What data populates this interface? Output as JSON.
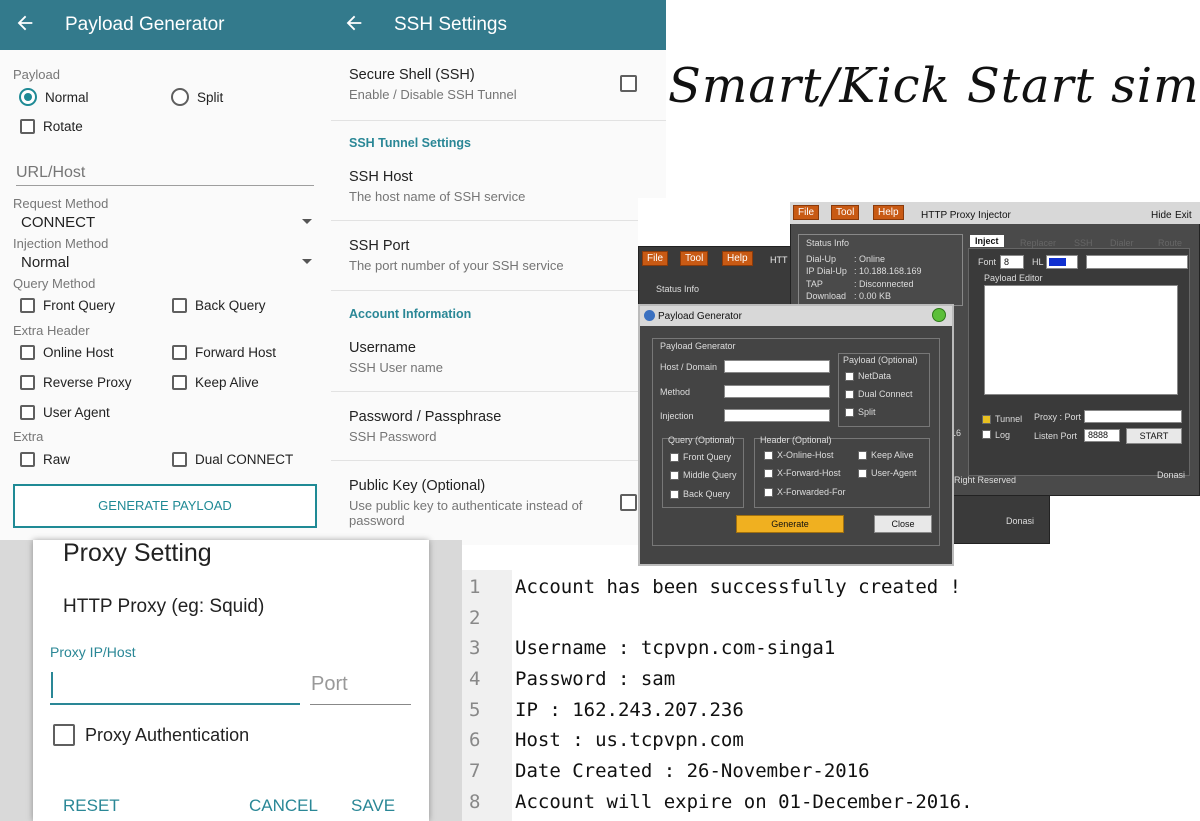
{
  "payload_generator": {
    "title": "Payload Generator",
    "payload_label": "Payload",
    "normal": "Normal",
    "split": "Split",
    "rotate": "Rotate",
    "url_placeholder": "URL/Host",
    "request_method_label": "Request Method",
    "request_method_value": "CONNECT",
    "injection_method_label": "Injection Method",
    "injection_method_value": "Normal",
    "query_method_label": "Query Method",
    "front_query": "Front Query",
    "back_query": "Back Query",
    "extra_header_label": "Extra Header",
    "online_host": "Online Host",
    "forward_host": "Forward Host",
    "reverse_proxy": "Reverse Proxy",
    "keep_alive": "Keep Alive",
    "user_agent": "User Agent",
    "extra_label": "Extra",
    "raw": "Raw",
    "dual_connect": "Dual CONNECT",
    "generate_button": "GENERATE PAYLOAD"
  },
  "ssh_settings": {
    "title": "SSH Settings",
    "secure_shell": "Secure Shell (SSH)",
    "secure_shell_sub": "Enable / Disable SSH Tunnel",
    "tunnel_section": "SSH Tunnel Settings",
    "ssh_host": "SSH Host",
    "ssh_host_sub": "The host name of SSH service",
    "ssh_port": "SSH Port",
    "ssh_port_sub": "The port number of your SSH service",
    "account_section": "Account Information",
    "username": "Username",
    "username_sub": "SSH User name",
    "password": "Password / Passphrase",
    "password_sub": "SSH Password",
    "public_key": "Public Key (Optional)",
    "public_key_sub": "Use public key to authenticate instead of password"
  },
  "proxy_setting": {
    "title": "Proxy Setting",
    "subtitle": "HTTP Proxy (eg: Squid)",
    "ip_label": "Proxy IP/Host",
    "port_placeholder": "Port",
    "auth": "Proxy Authentication",
    "reset": "RESET",
    "cancel": "CANCEL",
    "save": "SAVE"
  },
  "handwritten_title": "Smart/Kick Start sim",
  "injector": {
    "menu_file": "File",
    "menu_tool": "Tool",
    "menu_help": "Help",
    "title": "HTTP Proxy Injector",
    "hide": "Hide",
    "exit": "Exit",
    "status_info": "Status Info",
    "dialup": "Dial-Up",
    "dialup_val": ": Online",
    "ip_dialup": "IP Dial-Up",
    "ip_val": ": 10.188.168.169",
    "tap": "TAP",
    "tap_val": ": Disconnected",
    "download": "Download",
    "download_val": ": 0.00 KB",
    "tabs": [
      "Inject",
      "Replacer",
      "SSH",
      "Dialer",
      "Route"
    ],
    "font_label": "Font",
    "font_size": "8",
    "hl_label": "HL",
    "payload_editor": "Payload Editor",
    "tunnel": "Tunnel",
    "log": "Log",
    "proxy_port": "Proxy : Port",
    "listen_port": "Listen Port",
    "listen_value": "8888",
    "start": "START",
    "right_reserved": "Right Reserved",
    "donasi": "Donasi",
    "dialog_title": "Payload Generator",
    "dialog_group": "Payload Generator",
    "host_domain": "Host / Domain",
    "method": "Method",
    "injection": "Injection",
    "payload_optional": "Payload (Optional)",
    "netdata": "NetData",
    "dual_connect": "Dual Connect",
    "split": "Split",
    "query_optional": "Query (Optional)",
    "front_query": "Front Query",
    "middle_query": "Middle Query",
    "back_query": "Back Query",
    "header_optional": "Header (Optional)",
    "x_online_host": "X-Online-Host",
    "x_forward_host": "X-Forward-Host",
    "x_forwarded_for": "X-Forwarded-For",
    "keep_alive": "Keep Alive",
    "user_agent": "User-Agent",
    "generate": "Generate",
    "close": "Close",
    "back_status_info": "Status Info",
    "back_title_partial": "HTT",
    "side_16": "16"
  },
  "code_editor": {
    "lines": [
      {
        "num": "1",
        "text": "Account has been successfully created !"
      },
      {
        "num": "2",
        "text": ""
      },
      {
        "num": "3",
        "text": "Username : tcpvpn.com-singa1"
      },
      {
        "num": "4",
        "text": "Password : sam"
      },
      {
        "num": "5",
        "text": "IP : 162.243.207.236"
      },
      {
        "num": "6",
        "text": "Host : us.tcpvpn.com"
      },
      {
        "num": "7",
        "text": "Date Created : 26-November-2016"
      },
      {
        "num": "8",
        "text": "Account will expire on 01-December-2016."
      }
    ]
  },
  "colors": {
    "appbar": "#337a8c",
    "accent": "#1f8a95",
    "win_orange": "#c85a14",
    "generate_yellow": "#f0b020"
  }
}
